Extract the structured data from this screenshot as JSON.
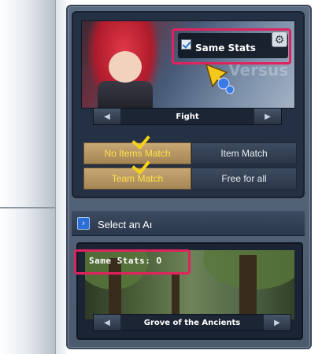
{
  "mode_panel": {
    "banner_text": "Versus",
    "same_stats_label": "Same Stats",
    "same_stats_checked": true,
    "settings_icon": "gear-icon",
    "mode_name": "Fight",
    "prev_icon": "triangle-left-icon",
    "next_icon": "triangle-right-icon"
  },
  "match_options": [
    {
      "label": "No Items Match",
      "selected": true
    },
    {
      "label": "Item Match",
      "selected": false
    },
    {
      "label": "Team Match",
      "selected": true
    },
    {
      "label": "Free for all",
      "selected": false
    }
  ],
  "ai_section": {
    "title": "Select an Aı",
    "header_icon": "chevron-right-icon",
    "same_stats_count": "Same Stats: O",
    "map_name": "Grove of the Ancients"
  },
  "colors": {
    "highlight": "#e2225e",
    "selected_text": "#ffe24a",
    "check_yellow": "#f4d21a"
  }
}
